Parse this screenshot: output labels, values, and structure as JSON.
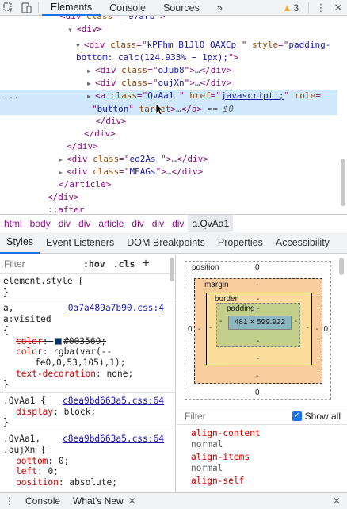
{
  "toolbar": {
    "tabs": [
      "Elements",
      "Console",
      "Sources"
    ],
    "more": "»",
    "warnings": "3",
    "kebab": "⋮",
    "close": "✕"
  },
  "tree": {
    "l0": {
      "pre": "<div class=\"",
      "cls": "_97arb",
      "post": "\">"
    },
    "l1": "<div>",
    "l2a": {
      "attr1": "class",
      "v1": "kPFhm B1JlO OAXCp ",
      "attr2": "style",
      "v2": "padding-"
    },
    "l2b": "bottom: calc(124.933% − 1px);",
    "l3": {
      "attr": "class",
      "v": "oJub8"
    },
    "l4": {
      "attr": "class",
      "v": "oujXn"
    },
    "l5": {
      "dots": "...",
      "attr1": "class",
      "v1": "QvAa1 ",
      "attr2": "href",
      "v2": "javascript:;",
      "attr3": "role"
    },
    "l5b": {
      "v": "button",
      "attr": "target",
      "eq": "== $0"
    },
    "close_div": "</div>",
    "close_div2": "</div>",
    "close_div3": "</div>",
    "l9": {
      "attr": "class",
      "v": "eo2As "
    },
    "l10": {
      "attr": "class",
      "v": "MEAGs"
    },
    "l11": "</article>",
    "l12": "</div>",
    "l13": "::after"
  },
  "breadcrumb": [
    "html",
    "body",
    "div",
    "div",
    "article",
    "div",
    "div",
    "div",
    "a.QvAa1"
  ],
  "subtabs": [
    "Styles",
    "Event Listeners",
    "DOM Breakpoints",
    "Properties",
    "Accessibility"
  ],
  "styles": {
    "filter_placeholder": "Filter",
    "hov": ":hov",
    "cls": ".cls",
    "plus": "+",
    "element_style": "element.style {",
    "close_brace": "}",
    "rule1": {
      "selector": "a,",
      "selector2": "a:visited",
      "source": "0a7a489a7b90.css:4",
      "open": "{",
      "p1_name": "color",
      "p1_value": "#003569;",
      "p2_name": "color",
      "p2_value": "rgba(var(--",
      "p2_value_cont": "fe0,0,53,105),1);",
      "p3_name": "text-decoration",
      "p3_value": "none;"
    },
    "rule2": {
      "selector": ".QvAa1 {",
      "source": "c8ea9bd663a5.css:64",
      "p1_name": "display",
      "p1_value": "block;"
    },
    "rule3": {
      "selector": ".QvAa1,",
      "selector2": ".oujXn {",
      "source": "c8ea9bd663a5.css:64",
      "p1_name": "bottom",
      "p1_value": "0;",
      "p2_name": "left",
      "p2_value": "0;",
      "p3_name": "position",
      "p3_value": "absolute;"
    }
  },
  "boxmodel": {
    "position_label": "position",
    "position_top": "0",
    "position_left": "0",
    "position_right": "0",
    "position_bottom": "0",
    "margin_label": "margin",
    "margin_top": "-",
    "margin_left": "-",
    "margin_right": "-",
    "margin_bottom": "-",
    "border_label": "border",
    "border_top": "-",
    "border_left": "-",
    "border_right": "-",
    "border_bottom": "-",
    "padding_label": "padding -",
    "padding_left": "-",
    "padding_right": "-",
    "padding_bottom": "-",
    "content": "481 × 599.922"
  },
  "computed": {
    "filter_placeholder": "Filter",
    "show_all": "Show all",
    "props": [
      {
        "name": "align-content",
        "value": "normal"
      },
      {
        "name": "align-items",
        "value": "normal"
      },
      {
        "name": "align-self",
        "value": ""
      }
    ]
  },
  "drawer": {
    "tabs": [
      "Console",
      "What's New"
    ],
    "close": "✕"
  },
  "colors": {
    "accent": "#1a73e8",
    "selected_row": "#cfe8fc",
    "tag": "#881280",
    "attr": "#994500",
    "value": "#1a1aa6",
    "swatch": "#003569"
  }
}
